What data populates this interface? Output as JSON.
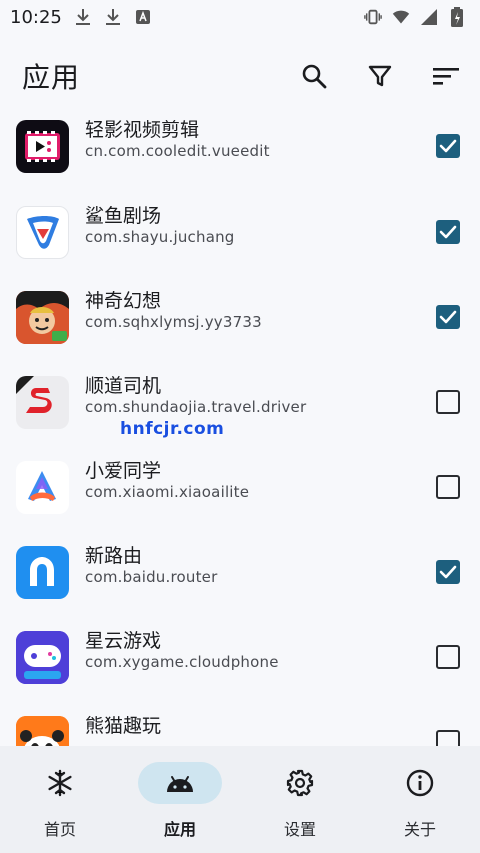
{
  "status": {
    "time": "10:25"
  },
  "header": {
    "title": "应用"
  },
  "apps": [
    {
      "name": "轻影视频剪辑",
      "package": "cn.com.cooledit.vueedit",
      "checked": true
    },
    {
      "name": "鲨鱼剧场",
      "package": "com.shayu.juchang",
      "checked": true
    },
    {
      "name": "神奇幻想",
      "package": "com.sqhxlymsj.yy3733",
      "checked": true
    },
    {
      "name": "顺道司机",
      "package": "com.shundaojia.travel.driver",
      "checked": false
    },
    {
      "name": "小爱同学",
      "package": "com.xiaomi.xiaoailite",
      "checked": false
    },
    {
      "name": "新路由",
      "package": "com.baidu.router",
      "checked": true
    },
    {
      "name": "星云游戏",
      "package": "com.xygame.cloudphone",
      "checked": false
    },
    {
      "name": "熊猫趣玩",
      "package": "",
      "checked": false
    }
  ],
  "watermark": "hnfcjr.com",
  "nav": [
    {
      "label": "首页",
      "icon": "snowflake-icon",
      "active": false
    },
    {
      "label": "应用",
      "icon": "android-icon",
      "active": true
    },
    {
      "label": "设置",
      "icon": "gear-icon",
      "active": false
    },
    {
      "label": "关于",
      "icon": "info-icon",
      "active": false
    }
  ],
  "colors": {
    "accent": "#1d5f7e",
    "nav_active_pill": "#cfe5f0",
    "background": "#f7f8fb"
  }
}
